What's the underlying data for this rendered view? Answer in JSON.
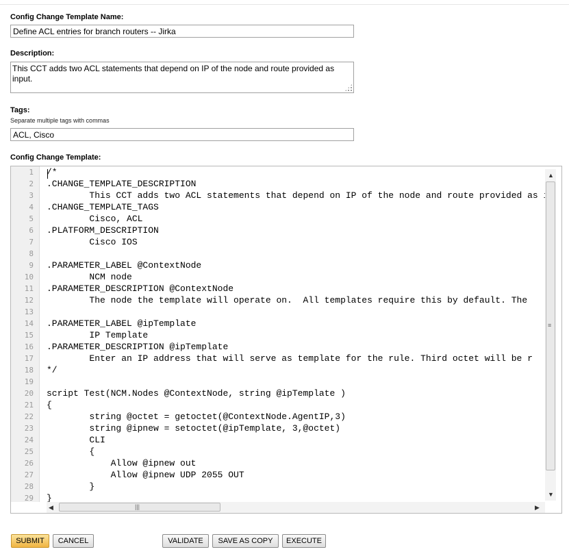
{
  "form": {
    "name_label": "Config Change Template Name:",
    "name_value": "Define ACL entries for branch routers -- Jirka",
    "description_label": "Description:",
    "description_value": "This CCT adds two ACL statements that depend on IP of the node and route provided as input.",
    "tags_label": "Tags:",
    "tags_hint": "Separate multiple tags with commas",
    "tags_value": "ACL, Cisco",
    "template_label": "Config Change Template:"
  },
  "editor": {
    "lines": [
      "/*",
      ".CHANGE_TEMPLATE_DESCRIPTION",
      "        This CCT adds two ACL statements that depend on IP of the node and route provided as input.",
      ".CHANGE_TEMPLATE_TAGS",
      "        Cisco, ACL",
      ".PLATFORM_DESCRIPTION",
      "        Cisco IOS",
      "",
      ".PARAMETER_LABEL @ContextNode",
      "        NCM node",
      ".PARAMETER_DESCRIPTION @ContextNode",
      "        The node the template will operate on.  All templates require this by default. The",
      "",
      ".PARAMETER_LABEL @ipTemplate",
      "        IP Template",
      ".PARAMETER_DESCRIPTION @ipTemplate",
      "        Enter an IP address that will serve as template for the rule. Third octet will be r",
      "*/",
      "",
      "script Test(NCM.Nodes @ContextNode, string @ipTemplate )",
      "{",
      "        string @octet = getoctet(@ContextNode.AgentIP,3)",
      "        string @ipnew = setoctet(@ipTemplate, 3,@octet)",
      "        CLI",
      "        {",
      "            Allow @ipnew out",
      "            Allow @ipnew UDP 2055 OUT",
      "        }",
      "}",
      ""
    ]
  },
  "buttons": {
    "submit": "SUBMIT",
    "cancel": "CANCEL",
    "validate": "VALIDATE",
    "save_as_copy": "SAVE AS COPY",
    "execute": "EXECUTE"
  }
}
